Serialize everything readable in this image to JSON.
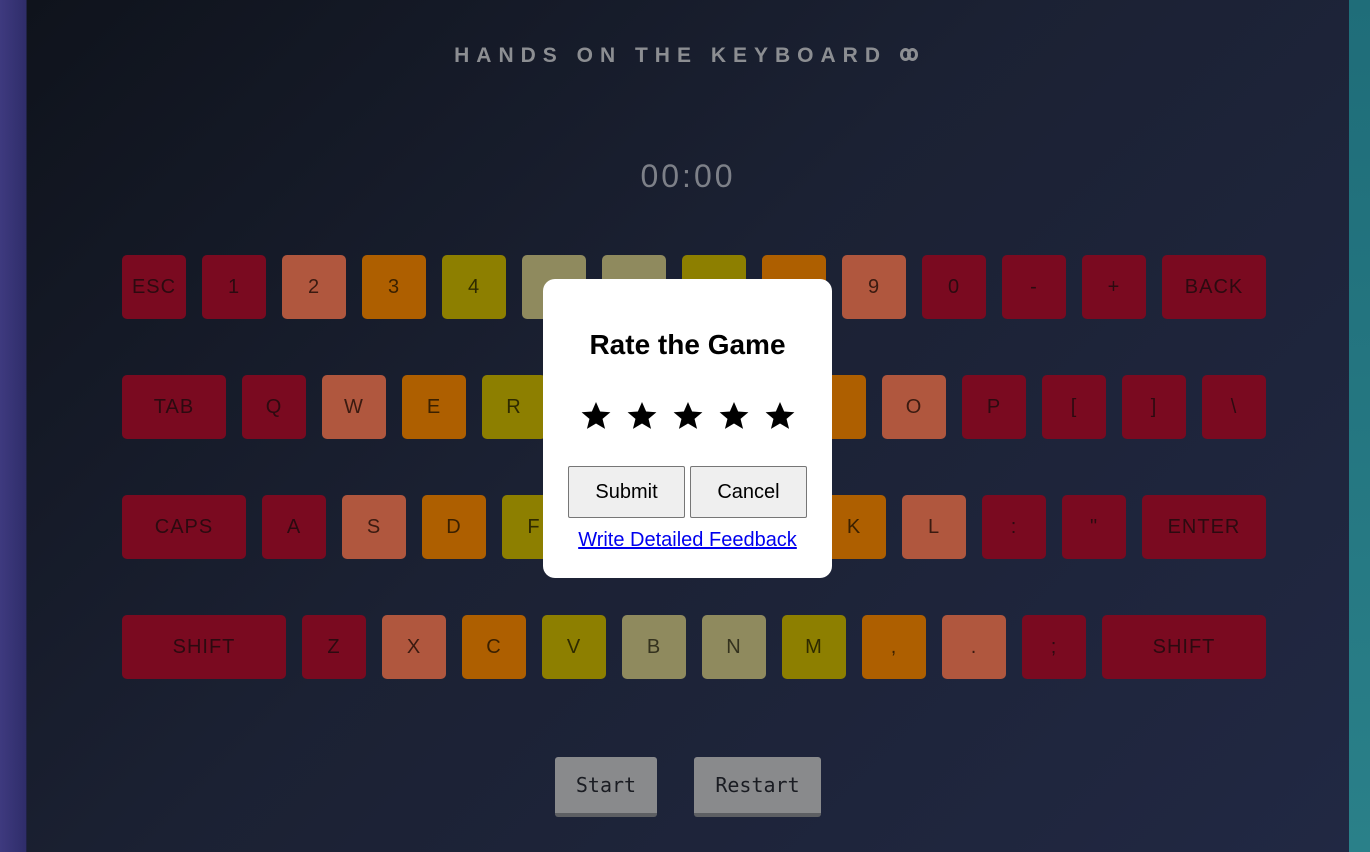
{
  "title": "HANDS ON THE KEYBOARD",
  "title_icon": "infinity-icon",
  "timer": "00:00",
  "colors": {
    "red": "#7a0a20",
    "salmon": "#b0573e",
    "orange": "#ae5f00",
    "yellow": "#8d7f00",
    "khaki": "#8f8a5e"
  },
  "keyboard": {
    "row1": [
      "ESC",
      "1",
      "2",
      "3",
      "4",
      "",
      "",
      "",
      "",
      "9",
      "0",
      "-",
      "+",
      "BACK"
    ],
    "row2": [
      "TAB",
      "Q",
      "W",
      "E",
      "R",
      "",
      "",
      "",
      "",
      "O",
      "P",
      "[",
      "]",
      "\\"
    ],
    "row3": [
      "CAPS",
      "A",
      "S",
      "D",
      "F",
      "",
      "",
      "",
      "K",
      "L",
      ":",
      "\"",
      "ENTER"
    ],
    "row4": [
      "SHIFT",
      "Z",
      "X",
      "C",
      "V",
      "B",
      "N",
      "M",
      ",",
      ".",
      ";",
      "SHIFT"
    ]
  },
  "controls": {
    "start_label": "Start",
    "restart_label": "Restart"
  },
  "modal": {
    "title": "Rate the Game",
    "star_count": 5,
    "star_icon": "star-icon",
    "submit_label": "Submit",
    "cancel_label": "Cancel",
    "feedback_link": "Write Detailed Feedback"
  }
}
